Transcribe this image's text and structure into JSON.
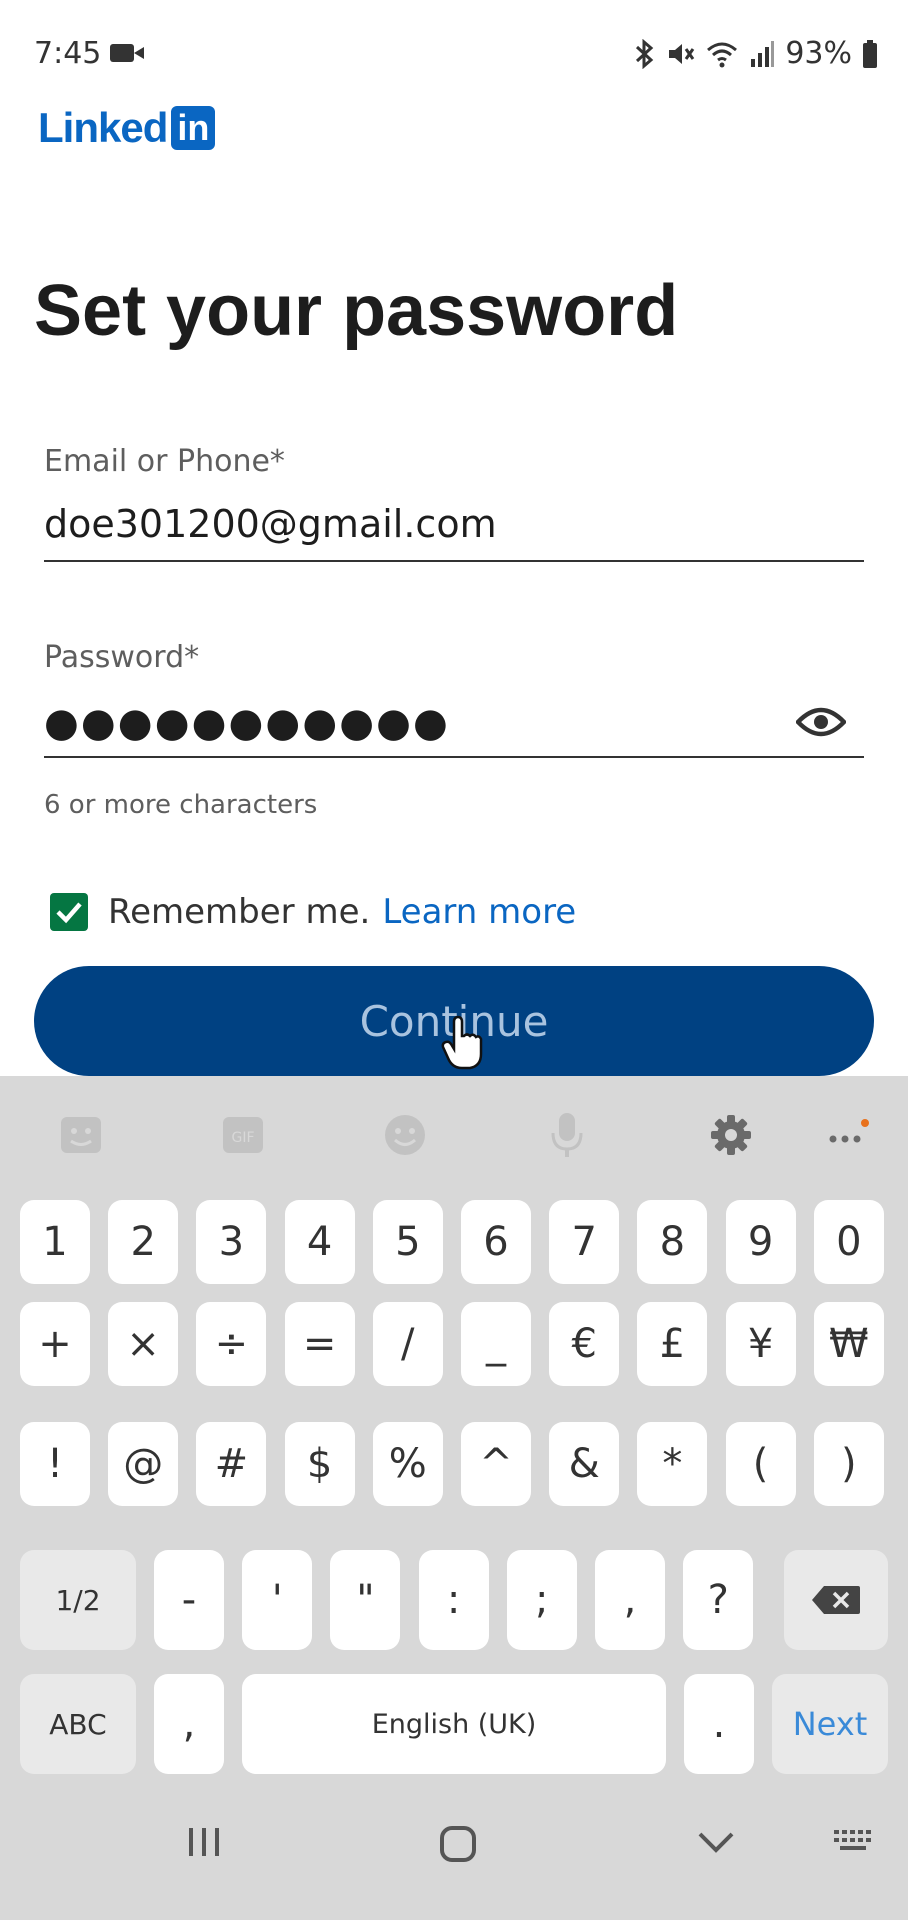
{
  "status_bar": {
    "time": "7:45",
    "battery": "93%"
  },
  "logo": {
    "text": "Linked",
    "box_text": "in",
    "color": "#0a66c2"
  },
  "title": "Set your password",
  "email": {
    "label": "Email or Phone*",
    "value": "doe301200@gmail.com"
  },
  "password": {
    "label": "Password*",
    "masked_value": "●●●●●●●●●●●",
    "helper": "6 or more characters"
  },
  "remember": {
    "label": "Remember me.",
    "link": "Learn more",
    "checked": true
  },
  "continue_button": {
    "label": "Continue",
    "color": "#004182"
  },
  "keyboard": {
    "row1": [
      "1",
      "2",
      "3",
      "4",
      "5",
      "6",
      "7",
      "8",
      "9",
      "0"
    ],
    "row2": [
      "+",
      "×",
      "÷",
      "=",
      "/",
      "_",
      "€",
      "£",
      "¥",
      "₩"
    ],
    "row3": [
      "!",
      "@",
      "#",
      "$",
      "%",
      "^",
      "&",
      "*",
      "(",
      ")"
    ],
    "row4": [
      "1/2",
      "-",
      "'",
      "\"",
      ":",
      ";",
      ",",
      "?"
    ],
    "row5": {
      "abc": "ABC",
      "comma": ",",
      "space": "English (UK)",
      "period": ".",
      "next": "Next"
    },
    "toolbar_gif": "GIF"
  }
}
